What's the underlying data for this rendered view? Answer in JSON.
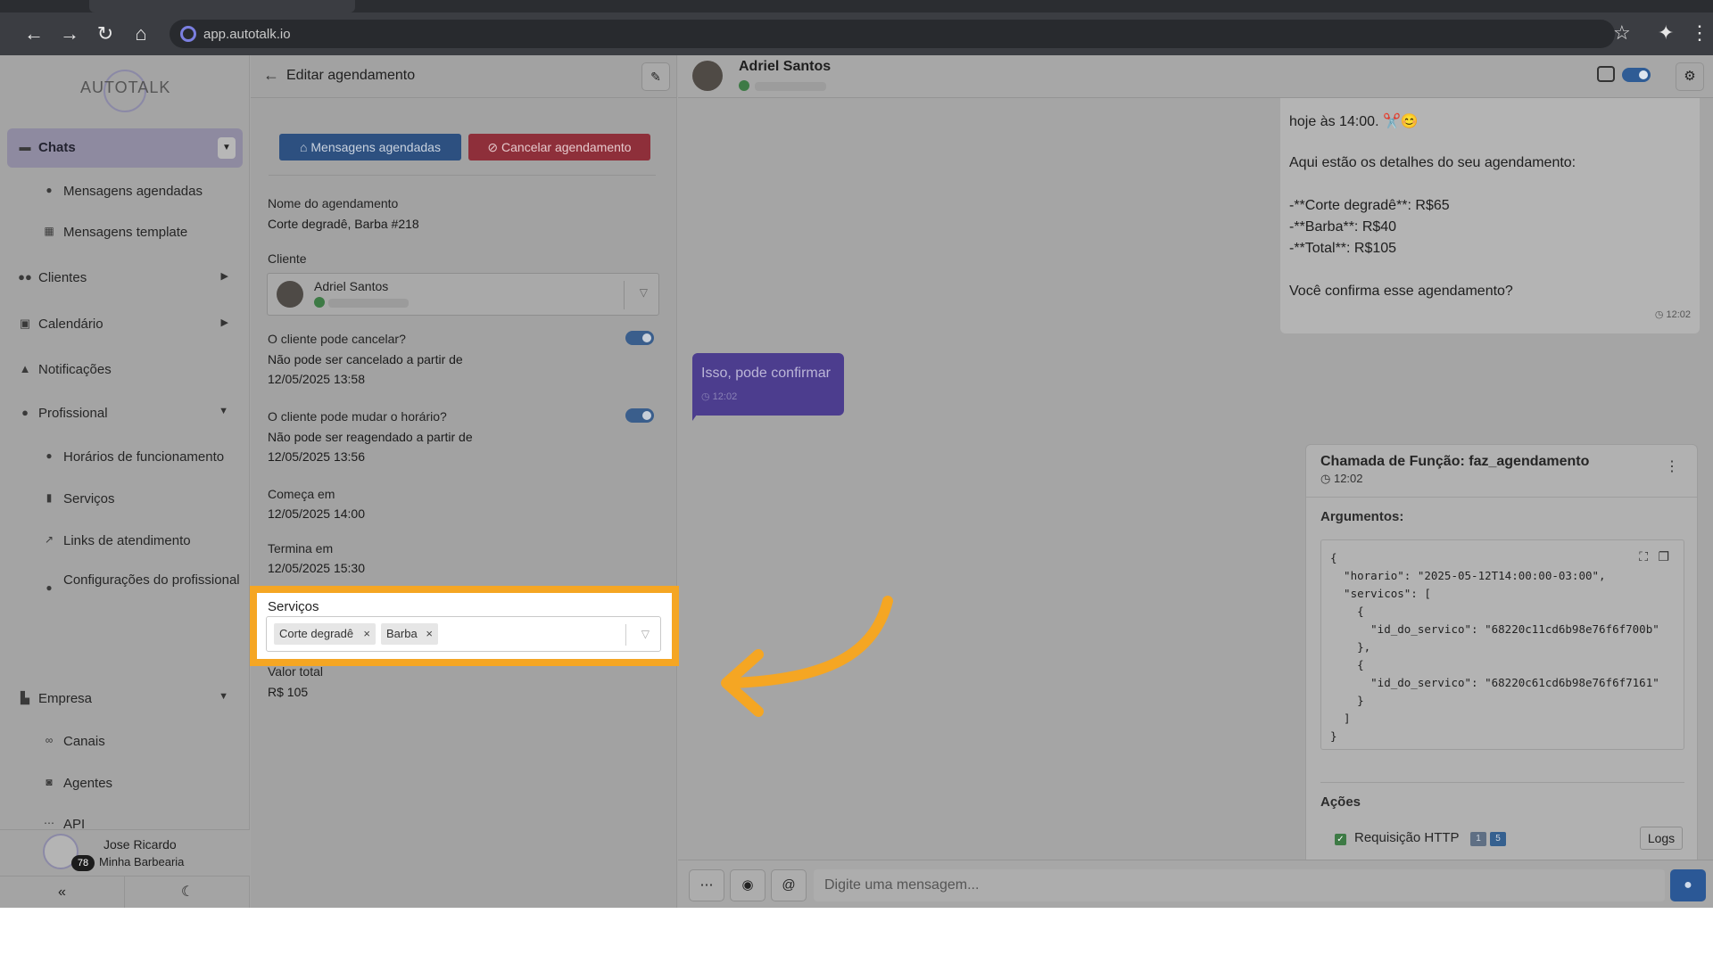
{
  "browser": {
    "url": "app.autotalk.io"
  },
  "sidebar": {
    "logo": "AUTOTALK",
    "items": [
      {
        "label": "Chats",
        "icon": "chat-icon"
      },
      {
        "label": "Mensagens agendadas",
        "icon": "clock-icon"
      },
      {
        "label": "Mensagens template",
        "icon": "template-icon"
      },
      {
        "label": "Clientes",
        "icon": "users-icon"
      },
      {
        "label": "Calendário",
        "icon": "calendar-icon"
      },
      {
        "label": "Notificações",
        "icon": "bell-icon"
      },
      {
        "label": "Profissional",
        "icon": "user-tie-icon"
      },
      {
        "label": "Horários de funcionamento",
        "icon": "clock-icon"
      },
      {
        "label": "Serviços",
        "icon": "clipboard-icon"
      },
      {
        "label": "Links de atendimento",
        "icon": "external-link-icon"
      },
      {
        "label": "Configurações do profissional",
        "icon": "user-cog-icon"
      },
      {
        "label": "Empresa",
        "icon": "building-icon"
      },
      {
        "label": "Canais",
        "icon": "link-icon"
      },
      {
        "label": "Agentes",
        "icon": "robot-icon"
      },
      {
        "label": "API",
        "icon": "api-icon"
      }
    ],
    "user": {
      "name": "Jose Ricardo",
      "business": "Minha Barbearia",
      "badge": "78"
    }
  },
  "edit_panel": {
    "title": "Editar agendamento",
    "btn_scheduled": "Mensagens agendadas",
    "btn_cancel": "Cancelar agendamento",
    "name_label": "Nome do agendamento",
    "name_value": "Corte degradê, Barba #218",
    "client_label": "Cliente",
    "client_name": "Adriel Santos",
    "can_cancel_label": "O cliente pode cancelar?",
    "can_cancel_value": "Não pode ser cancelado a partir de",
    "can_cancel_date": "12/05/2025 13:58",
    "can_reschedule_label": "O cliente pode mudar o horário?",
    "can_reschedule_value": "Não pode ser reagendado a partir de",
    "can_reschedule_date": "12/05/2025 13:56",
    "starts_label": "Começa em",
    "starts_value": "12/05/2025 14:00",
    "ends_label": "Termina em",
    "ends_value": "12/05/2025 15:30",
    "services_label": "Serviços",
    "services": [
      "Corte degradê",
      "Barba"
    ],
    "total_label": "Valor total",
    "total_value": "R$ 105"
  },
  "chat": {
    "contact_name": "Adriel Santos",
    "incoming_lines": [
      "hoje às 14:00. ✂️😊",
      "Aqui estão os detalhes do seu agendamento:",
      "-**Corte degradê**: R$65",
      "-**Barba**: R$40",
      "-**Total**: R$105",
      "Você confirma esse agendamento?"
    ],
    "incoming_time": "12:02",
    "outgoing_text": "Isso, pode confirmar",
    "outgoing_time": "12:02",
    "function_title": "Chamada de Função: faz_agendamento",
    "function_time": "12:02",
    "args_label": "Argumentos:",
    "code_lines": [
      "{",
      "  \"horario\": \"2025-05-12T14:00:00-03:00\",",
      "  \"servicos\": [",
      "    {",
      "      \"id_do_servico\": \"68220c11cd6b98e76f6f700b\"",
      "    },",
      "    {",
      "      \"id_do_servico\": \"68220c61cd6b98e76f6f7161\"",
      "    }",
      "  ]",
      "}"
    ],
    "actions_label": "Ações",
    "action_http": "Requisição HTTP",
    "action_badge_1": "1",
    "action_badge_2": "5",
    "logs_label": "Logs",
    "composer_placeholder": "Digite uma mensagem..."
  },
  "colors": {
    "highlight": "#f5a623",
    "arrow": "#f5a623",
    "outgoing_bubble": "#4c3d8e"
  }
}
